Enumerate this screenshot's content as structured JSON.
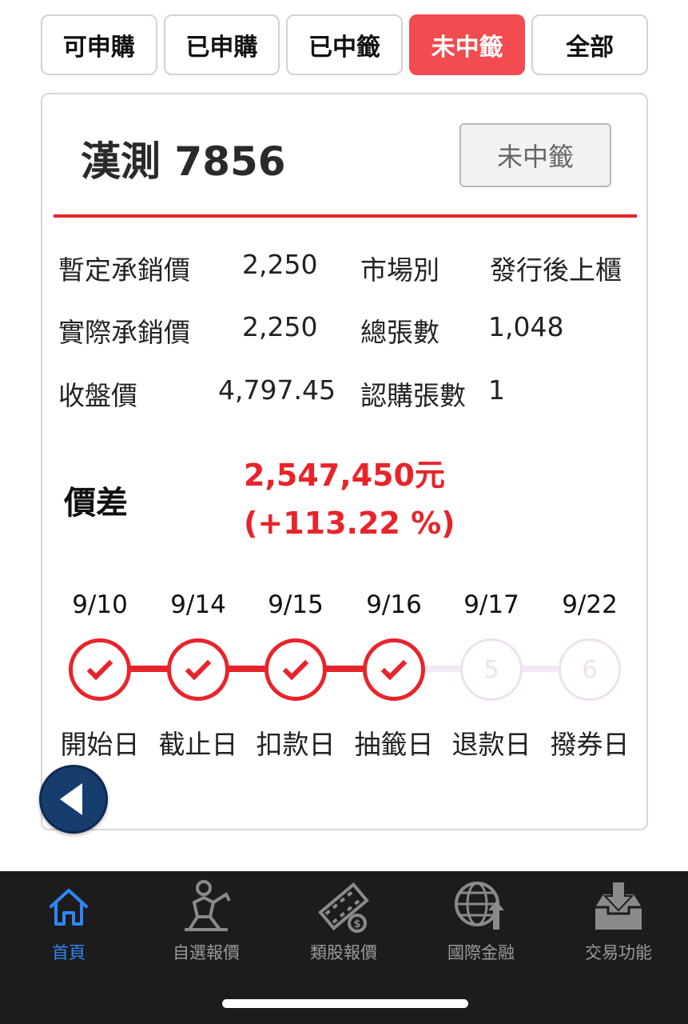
{
  "tabs": [
    {
      "label": "可申購",
      "active": false
    },
    {
      "label": "已申購",
      "active": false
    },
    {
      "label": "已中籤",
      "active": false
    },
    {
      "label": "未中籤",
      "active": true
    },
    {
      "label": "全部",
      "active": false
    }
  ],
  "stock": {
    "title": "漢測 7856",
    "status": "未中籤"
  },
  "info": {
    "tentative_price_label": "暫定承銷價",
    "tentative_price": "2,250",
    "market_label": "市場別",
    "market": "發行後上櫃",
    "actual_price_label": "實際承銷價",
    "actual_price": "2,250",
    "total_lots_label": "總張數",
    "total_lots": "1,048",
    "close_price_label": "收盤價",
    "close_price": "4,797.45",
    "subscribe_lots_label": "認購張數",
    "subscribe_lots": "1"
  },
  "diff": {
    "label": "價差",
    "value": "2,547,450元 (+113.22 %)"
  },
  "timeline": [
    {
      "date": "9/10",
      "label": "開始日",
      "done": true,
      "num": "1"
    },
    {
      "date": "9/14",
      "label": "截止日",
      "done": true,
      "num": "2"
    },
    {
      "date": "9/15",
      "label": "扣款日",
      "done": true,
      "num": "3"
    },
    {
      "date": "9/16",
      "label": "抽籤日",
      "done": true,
      "num": "4"
    },
    {
      "date": "9/17",
      "label": "退款日",
      "done": false,
      "num": "5"
    },
    {
      "date": "9/22",
      "label": "撥券日",
      "done": false,
      "num": "6"
    }
  ],
  "colors": {
    "accent_red": "#e8242b",
    "active_tab": "#f24b50",
    "nav_active": "#2f86f6",
    "back_button": "#163d6e"
  },
  "bottom_nav": [
    {
      "label": "首頁",
      "icon": "home-icon",
      "active": true
    },
    {
      "label": "自選報價",
      "icon": "person-chart-icon",
      "active": false
    },
    {
      "label": "類股報價",
      "icon": "film-coin-icon",
      "active": false
    },
    {
      "label": "國際金融",
      "icon": "globe-arrow-icon",
      "active": false
    },
    {
      "label": "交易功能",
      "icon": "inbox-download-icon",
      "active": false
    }
  ]
}
